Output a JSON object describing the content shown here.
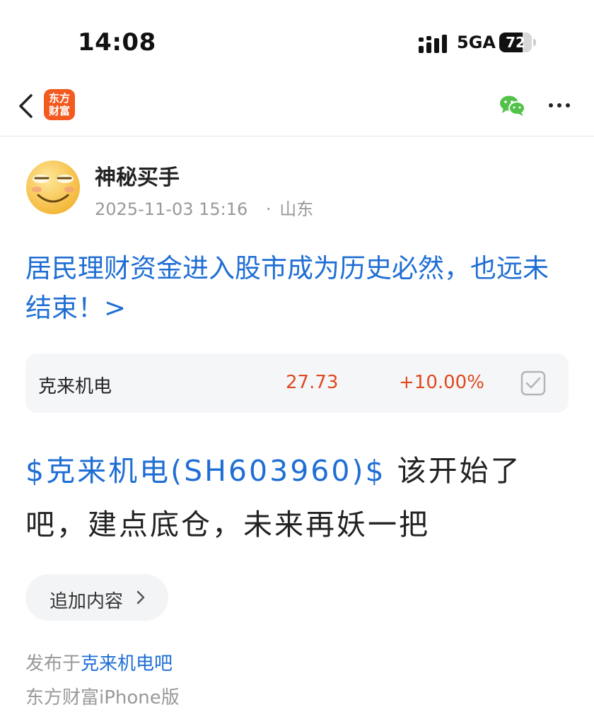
{
  "status_bar": {
    "time": "14:08",
    "network": "5GA",
    "battery": "72",
    "battery_level": 0.72
  },
  "nav": {
    "logo_line1": "东方",
    "logo_line2": "财富",
    "share_icon": "wechat-icon",
    "more_icon": "more-icon"
  },
  "author": {
    "name": "神秘买手",
    "datetime": "2025-11-03 15:16",
    "separator": "·",
    "location": "山东"
  },
  "post": {
    "title": "居民理财资金进入股市成为历史必然，也远未结束！>",
    "stock": {
      "name": "克来机电",
      "price": "27.73",
      "change": "+10.00%",
      "color_up": "#e0491f"
    },
    "body_tag": "$克来机电(SH603960)$",
    "body_text": " 该开始了吧，建点底仓，未来再妖一把"
  },
  "append_button": {
    "label": "追加内容"
  },
  "footer": {
    "posted_prefix": "发布于",
    "bar_name": "克来机电吧",
    "source": "东方财富iPhone版"
  },
  "colors": {
    "link": "#1f6ed4",
    "brand": "#f25a1f"
  }
}
